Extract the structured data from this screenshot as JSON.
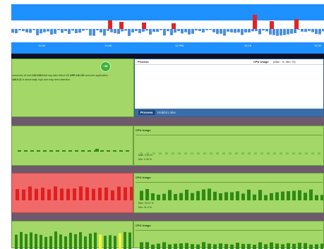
{
  "timeline": {
    "tick_labels": [
      "11:30",
      "11:45",
      "12 PM",
      "12:15",
      "12:30"
    ],
    "colors": {
      "background": "#1e90ff",
      "up_bar": "#e02424",
      "down_bar": "#4a90e2",
      "axis_band": "#1e90ff"
    }
  },
  "alert": {
    "text_pre": "resources at host",
    "host1": "192.168.0.11",
    "text_mid": "may later affect VM",
    "vm": "APP-LB-101",
    "text_post": "and web application",
    "line2_host": "168.0.11",
    "line2_text": "is abnormally high and may need attention.",
    "badge": "+88"
  },
  "process_table": {
    "columns": [
      "Process",
      "CPU Usage",
      "(Max : %, Min: %)"
    ],
    "tabs": [
      "Process",
      "Helpful Links"
    ]
  },
  "rows": [
    {
      "status": "green",
      "panel_title": "CPU Usage",
      "max": "Max: 0.94 %",
      "min": "Min: 0.39 %"
    },
    {
      "status": "red",
      "panel_title": "CPU Usage",
      "max": "Max: 93.11 %",
      "min": "Min: 31.4 %"
    },
    {
      "status": "green",
      "panel_title": "CPU Usage",
      "max": "",
      "min": ""
    }
  ],
  "colors": {
    "green": "#a3d768",
    "red": "#f06a6a",
    "dark_green": "#2e8b12",
    "yellow": "#f5f533",
    "divider": "#6e5a6c"
  }
}
